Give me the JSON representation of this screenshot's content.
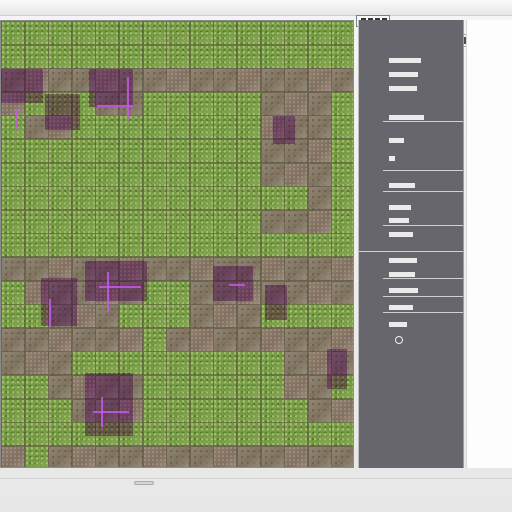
{
  "app": {
    "colors": {
      "map_grass": "#7ea24f",
      "map_path": "#8f8878",
      "accent_purple": "#a64be0",
      "inspector_bg": "#66666c",
      "pane_bg": "#fdfdfd"
    }
  },
  "map": {
    "columns": 15,
    "rows": 19
  },
  "inspector": {
    "icons": [
      "app-logo-icon",
      "toolbar-tool-icon",
      "inspector-row-icon",
      "dial-icon"
    ]
  }
}
